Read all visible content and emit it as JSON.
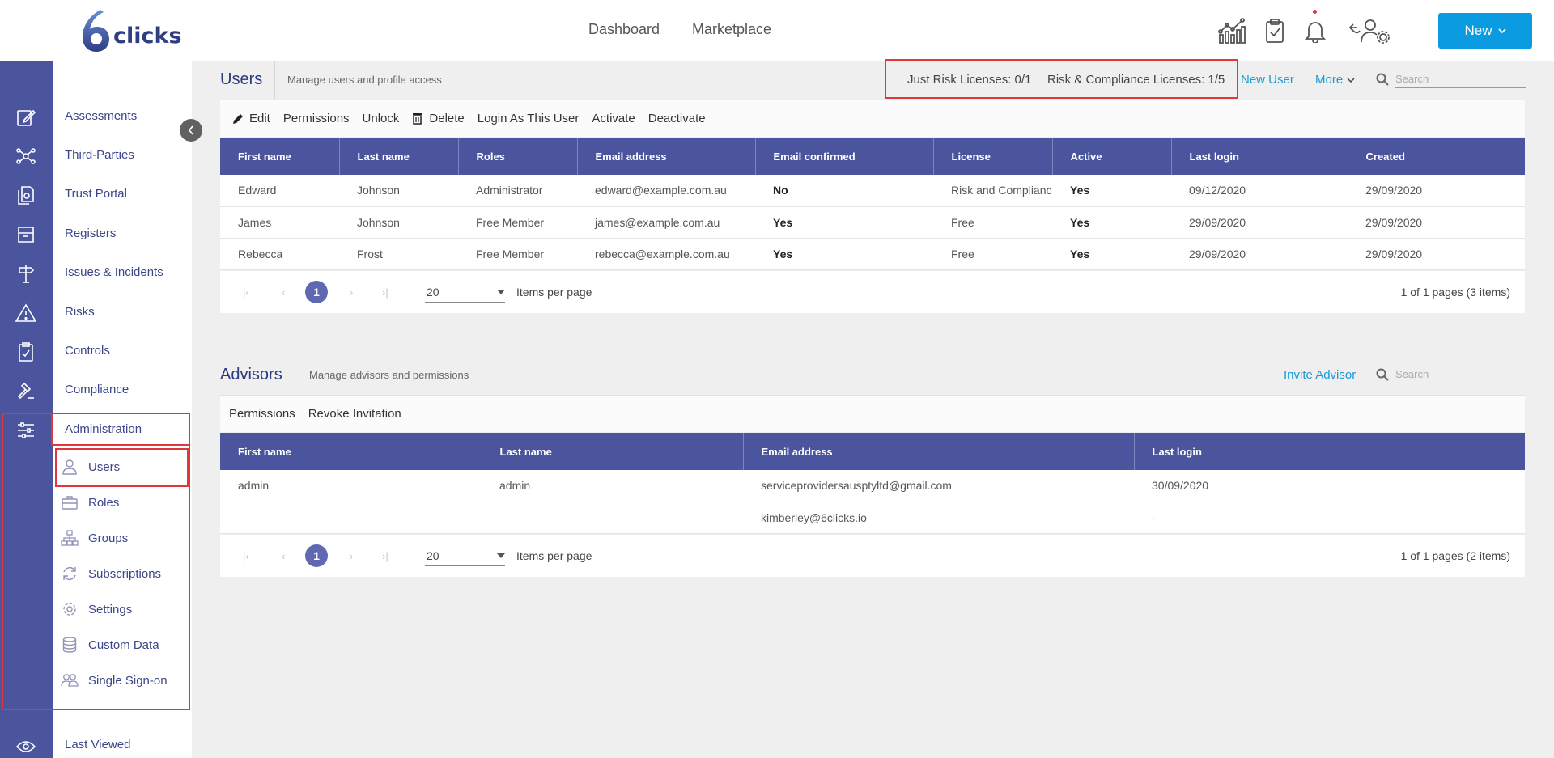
{
  "brand": {
    "logo_text": "clicks"
  },
  "topnav": {
    "dashboard": "Dashboard",
    "marketplace": "Marketplace"
  },
  "top_icons": [
    "analytics-icon",
    "task-clipboard-icon",
    "bell-icon",
    "user-settings-icon"
  ],
  "new_button": {
    "label": "New"
  },
  "sidebar": {
    "items": [
      {
        "label": "Assessments",
        "icon": "edit-icon"
      },
      {
        "label": "Third-Parties",
        "icon": "network-icon"
      },
      {
        "label": "Trust Portal",
        "icon": "documents-icon"
      },
      {
        "label": "Registers",
        "icon": "archive-box-icon"
      },
      {
        "label": "Issues & Incidents",
        "icon": "signpost-icon"
      },
      {
        "label": "Risks",
        "icon": "warning-icon"
      },
      {
        "label": "Controls",
        "icon": "checklist-icon"
      },
      {
        "label": "Compliance",
        "icon": "gavel-icon"
      },
      {
        "label": "Administration",
        "icon": "sliders-icon"
      }
    ],
    "admin_subitems": [
      {
        "label": "Users",
        "icon": "user-icon"
      },
      {
        "label": "Roles",
        "icon": "briefcase-icon"
      },
      {
        "label": "Groups",
        "icon": "hierarchy-icon"
      },
      {
        "label": "Subscriptions",
        "icon": "refresh-icon"
      },
      {
        "label": "Settings",
        "icon": "gear-icon"
      },
      {
        "label": "Custom Data",
        "icon": "database-icon"
      },
      {
        "label": "Single Sign-on",
        "icon": "users-icon"
      }
    ],
    "last_viewed": {
      "label": "Last Viewed",
      "icon": "eye-icon"
    }
  },
  "users_section": {
    "title": "Users",
    "subtitle": "Manage users and profile access",
    "licenses": {
      "just_risk": "Just Risk Licenses: 0/1",
      "risk_compliance": "Risk & Compliance Licenses: 1/5"
    },
    "new_user": "New User",
    "more": "More",
    "search_placeholder": "Search",
    "toolbar": [
      "Edit",
      "Permissions",
      "Unlock",
      "Delete",
      "Login As This User",
      "Activate",
      "Deactivate"
    ],
    "columns": [
      "First name",
      "Last name",
      "Roles",
      "Email address",
      "Email confirmed",
      "License",
      "Active",
      "Last login",
      "Created"
    ],
    "rows": [
      [
        "Edward",
        "Johnson",
        "Administrator",
        "edward@example.com.au",
        "No",
        "Risk and Compliance",
        "Yes",
        "09/12/2020",
        "29/09/2020"
      ],
      [
        "James",
        "Johnson",
        "Free Member",
        "james@example.com.au",
        "Yes",
        "Free",
        "Yes",
        "29/09/2020",
        "29/09/2020"
      ],
      [
        "Rebecca",
        "Frost",
        "Free Member",
        "rebecca@example.com.au",
        "Yes",
        "Free",
        "Yes",
        "29/09/2020",
        "29/09/2020"
      ]
    ],
    "pager": {
      "page": "1",
      "page_size": "20",
      "items_per_page": "Items per page",
      "info": "1 of 1 pages (3 items)"
    }
  },
  "advisors_section": {
    "title": "Advisors",
    "subtitle": "Manage advisors and permissions",
    "invite": "Invite Advisor",
    "search_placeholder": "Search",
    "toolbar": [
      "Permissions",
      "Revoke Invitation"
    ],
    "columns": [
      "First name",
      "Last name",
      "Email address",
      "Last login"
    ],
    "rows": [
      [
        "admin",
        "admin",
        "serviceprovidersausptyltd@gmail.com",
        "30/09/2020"
      ],
      [
        "",
        "",
        "kimberley@6clicks.io",
        "-"
      ]
    ],
    "pager": {
      "page": "1",
      "page_size": "20",
      "items_per_page": "Items per page",
      "info": "1 of 1 pages (2 items)"
    }
  },
  "colors": {
    "rail": "#4a559e",
    "header": "#4a559e",
    "accent": "#0b9be0",
    "link": "#1a9ad6",
    "highlight": "#e0373c"
  }
}
